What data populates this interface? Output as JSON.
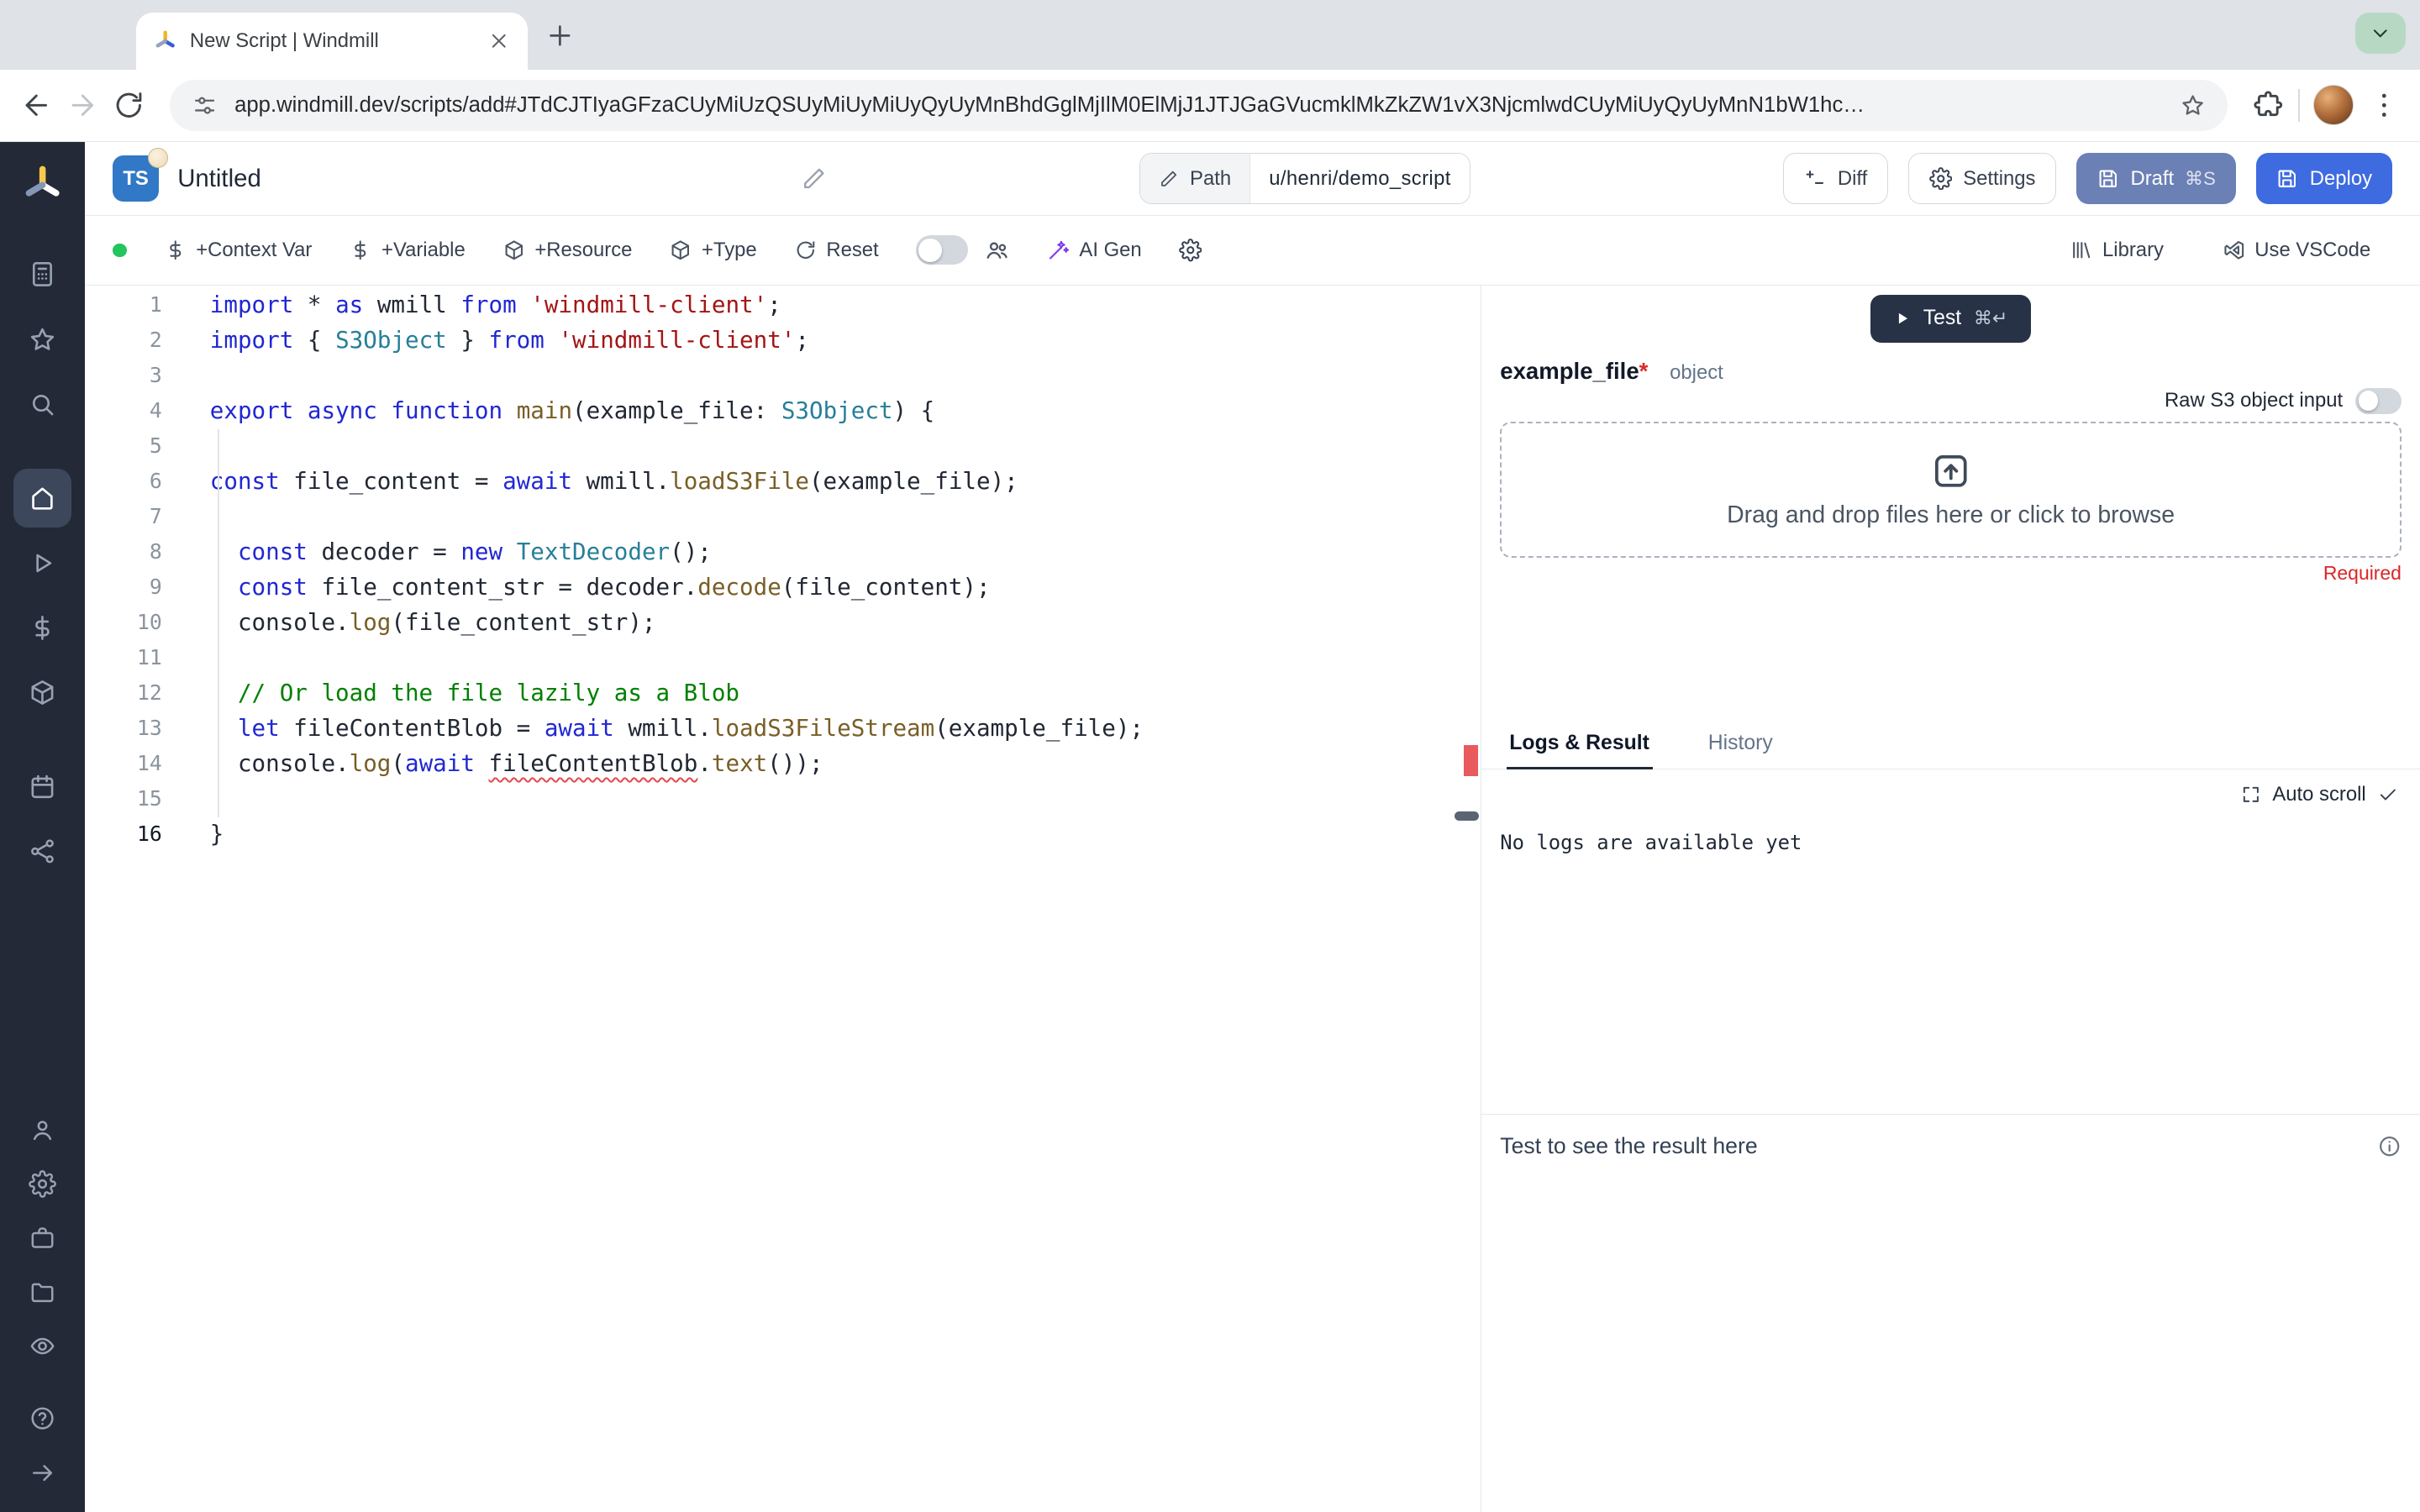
{
  "colors": {
    "deploy_blue": "#3e6be0",
    "draft_indigo": "#6b80b5",
    "ai_violet": "#7c3aed",
    "error_red": "#dc2626",
    "ready_green": "#22c55e",
    "ts_blue": "#3178c6",
    "sidebar_dark": "#232936"
  },
  "browser": {
    "tab_title": "New Script | Windmill",
    "url": "app.windmill.dev/scripts/add#JTdCJTIyaGFzaCUyMiUzQSUyMiUyMiUyQyUyMnBhdGglMjIlM0ElMjJ1JTJGaGVucmklMkZkZW1vX3NjcmlwdCUyMiUyQyUyMnN1bW1hc…"
  },
  "header": {
    "lang_badge": "TS",
    "title": "Untitled",
    "path_label": "Path",
    "path_value": "u/henri/demo_script",
    "diff_label": "Diff",
    "settings_label": "Settings",
    "draft_label": "Draft",
    "draft_shortcut": "⌘S",
    "deploy_label": "Deploy"
  },
  "toolbar": {
    "context_var": "+Context Var",
    "variable": "+Variable",
    "resource": "+Resource",
    "type": "+Type",
    "reset": "Reset",
    "ai_gen": "AI Gen",
    "library": "Library",
    "vscode": "Use VSCode"
  },
  "sidebar": {
    "active": "home",
    "groups_top": [
      [
        "apps",
        "favorites",
        "search"
      ],
      [
        "home",
        "runs",
        "variables",
        "resources"
      ],
      [
        "schedules",
        "workers"
      ]
    ],
    "groups_bottom": [
      [
        "user",
        "settings",
        "workspace",
        "folders",
        "audit"
      ],
      [
        "help",
        "collapse"
      ]
    ]
  },
  "editor": {
    "lines": [
      {
        "n": 1,
        "s": [
          [
            "k",
            "import"
          ],
          [
            "p",
            " * "
          ],
          [
            "k",
            "as"
          ],
          [
            "p",
            " wmill "
          ],
          [
            "k",
            "from"
          ],
          [
            "p",
            " "
          ],
          [
            "s",
            "'windmill-client'"
          ],
          [
            "p",
            ";"
          ]
        ]
      },
      {
        "n": 2,
        "s": [
          [
            "k",
            "import"
          ],
          [
            "p",
            " { "
          ],
          [
            "t",
            "S3Object"
          ],
          [
            "p",
            " } "
          ],
          [
            "k",
            "from"
          ],
          [
            "p",
            " "
          ],
          [
            "s",
            "'windmill-client'"
          ],
          [
            "p",
            ";"
          ]
        ]
      },
      {
        "n": 3,
        "s": []
      },
      {
        "n": 4,
        "s": [
          [
            "k",
            "export"
          ],
          [
            "p",
            " "
          ],
          [
            "k",
            "async"
          ],
          [
            "p",
            " "
          ],
          [
            "k",
            "function"
          ],
          [
            "p",
            " "
          ],
          [
            "f",
            "main"
          ],
          [
            "p",
            "(example_file: "
          ],
          [
            "t",
            "S3Object"
          ],
          [
            "p",
            ") {"
          ]
        ]
      },
      {
        "n": 5,
        "s": []
      },
      {
        "n": 6,
        "s": [
          [
            "k",
            "const"
          ],
          [
            "p",
            " file_content = "
          ],
          [
            "k",
            "await"
          ],
          [
            "p",
            " wmill."
          ],
          [
            "f",
            "loadS3File"
          ],
          [
            "p",
            "(example_file);"
          ]
        ]
      },
      {
        "n": 7,
        "s": []
      },
      {
        "n": 8,
        "s": [
          [
            "p",
            "  "
          ],
          [
            "k",
            "const"
          ],
          [
            "p",
            " decoder = "
          ],
          [
            "k",
            "new"
          ],
          [
            "p",
            " "
          ],
          [
            "t",
            "TextDecoder"
          ],
          [
            "p",
            "();"
          ]
        ]
      },
      {
        "n": 9,
        "s": [
          [
            "p",
            "  "
          ],
          [
            "k",
            "const"
          ],
          [
            "p",
            " file_content_str = decoder."
          ],
          [
            "f",
            "decode"
          ],
          [
            "p",
            "(file_content);"
          ]
        ]
      },
      {
        "n": 10,
        "s": [
          [
            "p",
            "  console."
          ],
          [
            "f",
            "log"
          ],
          [
            "p",
            "(file_content_str);"
          ]
        ]
      },
      {
        "n": 11,
        "s": []
      },
      {
        "n": 12,
        "s": [
          [
            "p",
            "  "
          ],
          [
            "c",
            "// Or load the file lazily as a Blob"
          ]
        ]
      },
      {
        "n": 13,
        "s": [
          [
            "p",
            "  "
          ],
          [
            "k",
            "let"
          ],
          [
            "p",
            " fileContentBlob = "
          ],
          [
            "k",
            "await"
          ],
          [
            "p",
            " wmill."
          ],
          [
            "f",
            "loadS3FileStream"
          ],
          [
            "p",
            "(example_file);"
          ]
        ]
      },
      {
        "n": 14,
        "s": [
          [
            "p",
            "  console."
          ],
          [
            "f",
            "log"
          ],
          [
            "p",
            "("
          ],
          [
            "k",
            "await"
          ],
          [
            "p",
            " "
          ],
          [
            "e",
            "fileContentBlob"
          ],
          [
            "p",
            "."
          ],
          [
            "f",
            "text"
          ],
          [
            "p",
            "());"
          ]
        ]
      },
      {
        "n": 15,
        "s": []
      },
      {
        "n": 16,
        "a": true,
        "s": [
          [
            "p",
            "}"
          ]
        ]
      }
    ]
  },
  "panel": {
    "test_label": "Test",
    "test_shortcut": "⌘↵",
    "arg_name": "example_file",
    "required_star": "*",
    "arg_type": "object",
    "raw_s3_label": "Raw S3 object input",
    "dropzone_text": "Drag and drop files here or click to browse",
    "required_label": "Required",
    "tab_logs": "Logs & Result",
    "tab_history": "History",
    "auto_scroll": "Auto scroll",
    "no_logs": "No logs are available yet",
    "result_placeholder": "Test to see the result here"
  }
}
